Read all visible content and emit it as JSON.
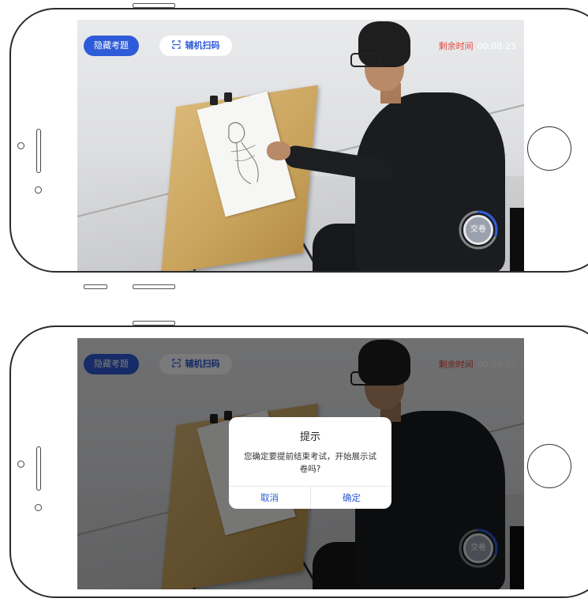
{
  "colors": {
    "accent_blue": "#2e5bd7",
    "timer_red": "#e8473e",
    "dialog_bg": "#ffffff",
    "dim_overlay": "rgba(0,0,0,0.52)"
  },
  "exam": {
    "hide_questions_label": "隐藏考题",
    "aux_scan_label": "辅机扫码",
    "scan_icon": "scan-icon",
    "remaining_time_label": "剩余时间",
    "remaining_time_value": "00:08:25",
    "submit_label": "交卷",
    "submit_progress": 0.3
  },
  "dialog": {
    "title": "提示",
    "message": "您确定要提前结束考试，开始展示试卷吗?",
    "cancel_label": "取消",
    "confirm_label": "确定"
  }
}
